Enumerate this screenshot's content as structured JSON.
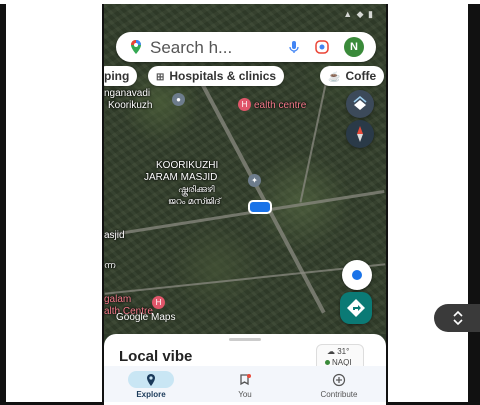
{
  "search": {
    "placeholder": "Search h...",
    "avatar_letter": "N"
  },
  "chips": [
    {
      "label": "ping",
      "icon": "shopping-icon"
    },
    {
      "label": "Hospitals & clinics",
      "icon": "hospital-icon"
    },
    {
      "label": "Coffe",
      "icon": "coffee-icon"
    }
  ],
  "map_labels": {
    "anganavadi": "nganavadi",
    "koorikuzhi_top": "Koorikuzh",
    "health_centre_top": "ealth centre",
    "masjid_line1": "KOORIKUZHI",
    "masjid_line2": "JARAM MASJID",
    "masjid_local1": "ഷ്കൂരിക്കുഴി",
    "masjid_local2": "ജറം മസ്ജിദ്",
    "asjid": "asjid",
    "local_small": "ന്ന",
    "galam": "galam",
    "health_centre_bottom": "alth Centre",
    "google_maps": "Google Maps"
  },
  "sheet": {
    "title": "Local vibe",
    "weather_temp": "31°",
    "air_quality": "NAQI"
  },
  "nav": [
    {
      "label": "Explore",
      "icon": "explore-icon",
      "active": true
    },
    {
      "label": "You",
      "icon": "you-icon",
      "active": false
    },
    {
      "label": "Contribute",
      "icon": "contribute-icon",
      "active": false
    }
  ],
  "colors": {
    "accent": "#1a73e8",
    "nav_active_pill": "#c9e6f4",
    "directions_fab": "#0b7a75",
    "health_label": "#f47a8a"
  }
}
